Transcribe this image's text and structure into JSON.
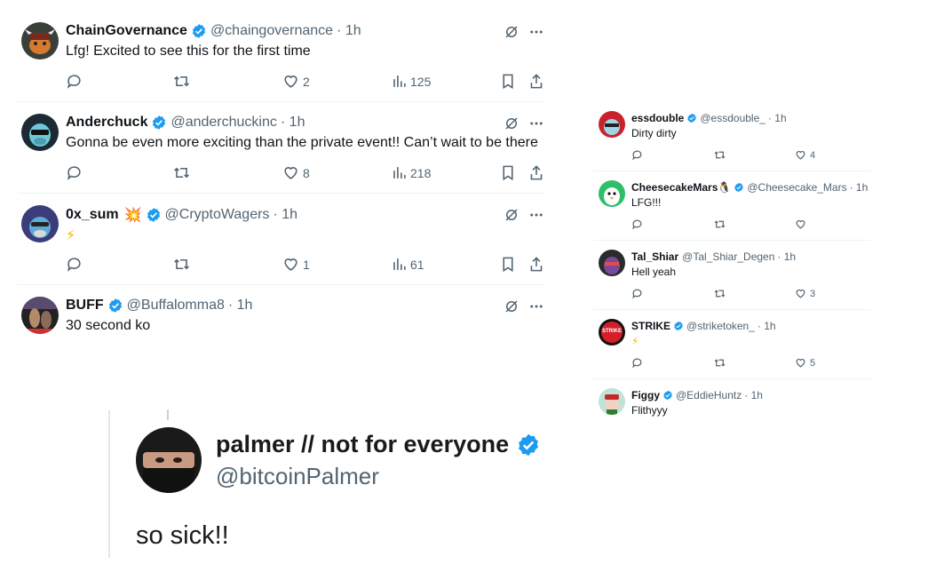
{
  "colors": {
    "verified": "#1d9bf0",
    "text": "#0f1419",
    "secondary": "#536471",
    "divider": "#eff3f4"
  },
  "left_replies": [
    {
      "name": "ChainGovernance",
      "handle": "@chaingovernance",
      "time": "· 1h",
      "text": "Lfg! Excited to see this for the first time",
      "likes": "2",
      "views": "125",
      "avatar_icon": "bull-avatar-icon"
    },
    {
      "name": "Anderchuck",
      "handle": "@anderchuckinc",
      "time": "· 1h",
      "text": "Gonna be even more exciting than the private event!! Can’t wait to be there",
      "likes": "8",
      "views": "218",
      "avatar_icon": "ape-avatar-icon"
    },
    {
      "name": "0x_sum",
      "emoji": "💥",
      "handle": "@CryptoWagers",
      "time": "· 1h",
      "text": "⚡",
      "likes": "1",
      "views": "61",
      "avatar_icon": "ape-avatar-icon"
    },
    {
      "name": "BUFF",
      "handle": "@Buffalomma8",
      "time": "· 1h",
      "text": "30 second ko",
      "avatar_icon": "fighter-avatar-icon"
    }
  ],
  "right_replies": [
    {
      "name": "essdouble",
      "handle": "@essdouble_",
      "time": "· 1h",
      "text": "Dirty dirty",
      "likes": "4"
    },
    {
      "name": "CheesecakeMars",
      "emoji": "🐧",
      "handle": "@Cheesecake_Mars",
      "time": "· 1h",
      "text": "LFG!!!",
      "likes": ""
    },
    {
      "name": "Tal_Shiar",
      "handle": "@Tal_Shiar_Degen",
      "time": "· 1h",
      "text": "Hell yeah",
      "likes": "3"
    },
    {
      "name": "STRIKE",
      "handle": "@striketoken_",
      "time": "· 1h",
      "text": "⚡",
      "likes": "5",
      "avatar_text": "STRIKE"
    },
    {
      "name": "Figgy",
      "handle": "@EddieHuntz",
      "time": "· 1h",
      "text": "Flithyyy"
    }
  ],
  "quote": {
    "name": "palmer // not for everyone",
    "handle": "@bitcoinPalmer",
    "text": "so sick!!"
  },
  "icons": [
    "grok-icon",
    "more-icon",
    "reply-icon",
    "retweet-icon",
    "like-icon",
    "views-icon",
    "bookmark-icon",
    "share-icon",
    "verified-badge-icon"
  ]
}
